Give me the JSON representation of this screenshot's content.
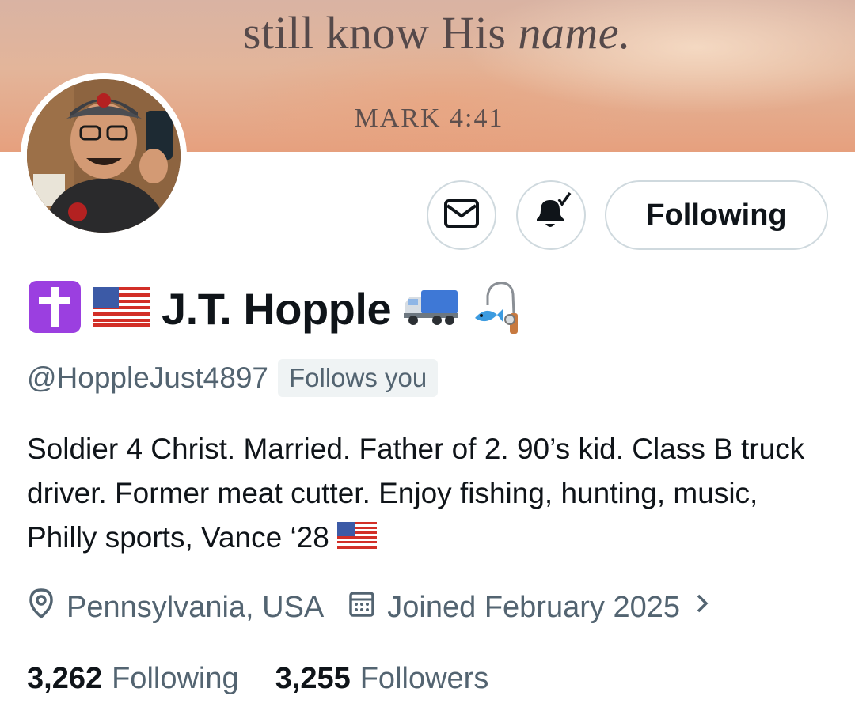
{
  "banner": {
    "line1_plain": "still know His ",
    "line1_italic": "name.",
    "line2": "MARK 4:41"
  },
  "actions": {
    "message_icon": "envelope-icon",
    "notify_icon": "bell-check-icon",
    "follow_label": "Following"
  },
  "profile": {
    "name": "J.T. Hopple",
    "name_prefix_icons": [
      "latin-cross-emoji",
      "us-flag-emoji"
    ],
    "name_suffix_icons": [
      "truck-emoji",
      "fishing-pole-emoji"
    ],
    "handle": "@HoppleJust4897",
    "follows_you": "Follows you",
    "bio": "Soldier 4 Christ. Married. Father of 2. 90’s kid. Class B truck driver. Former meat cutter. Enjoy fishing, hunting, music, Philly sports, Vance ‘28",
    "bio_suffix_icon": "us-flag-emoji",
    "location": "Pennsylvania, USA",
    "joined": "Joined February 2025",
    "following_count": "3,262",
    "following_label": "Following",
    "followers_count": "3,255",
    "followers_label": "Followers"
  },
  "colors": {
    "text_primary": "#0f1419",
    "text_secondary": "#536471",
    "border": "#cfd9de",
    "badge_bg": "#eff3f4",
    "cross_purple": "#9b3fe0"
  }
}
